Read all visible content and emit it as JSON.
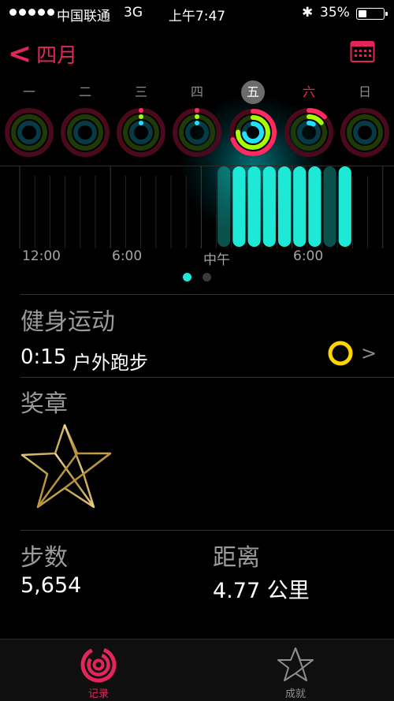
{
  "status_bar": {
    "carrier": "中国联通",
    "network": "3G",
    "time": "上午7:47",
    "battery_percent": "35%",
    "battery_level": 0.35
  },
  "nav": {
    "back_label": "四月"
  },
  "week": {
    "days": [
      "一",
      "二",
      "三",
      "四",
      "五",
      "六",
      "日"
    ],
    "selected_index": 4
  },
  "chart": {
    "x_labels": [
      "12:00",
      "6:00",
      "中午",
      "6:00"
    ]
  },
  "pager": {
    "count": 2,
    "active": 0
  },
  "workout": {
    "section_title": "健身运动",
    "duration": "0:15",
    "activity": "户外跑步"
  },
  "awards": {
    "section_title": "奖章"
  },
  "stats": {
    "steps_label": "步数",
    "steps_value": "5,654",
    "distance_label": "距离",
    "distance_value": "4.77 公里"
  },
  "tabs": [
    {
      "label": "记录",
      "active": true
    },
    {
      "label": "成就",
      "active": false
    }
  ],
  "colors": {
    "accent": "#e3265a",
    "move_ring": "#ff2a5f",
    "exercise_ring": "#a6ff00",
    "stand_ring": "#1fe0ff",
    "chart_bar": "#1de9d6",
    "workout_ring": "#ffd500"
  }
}
